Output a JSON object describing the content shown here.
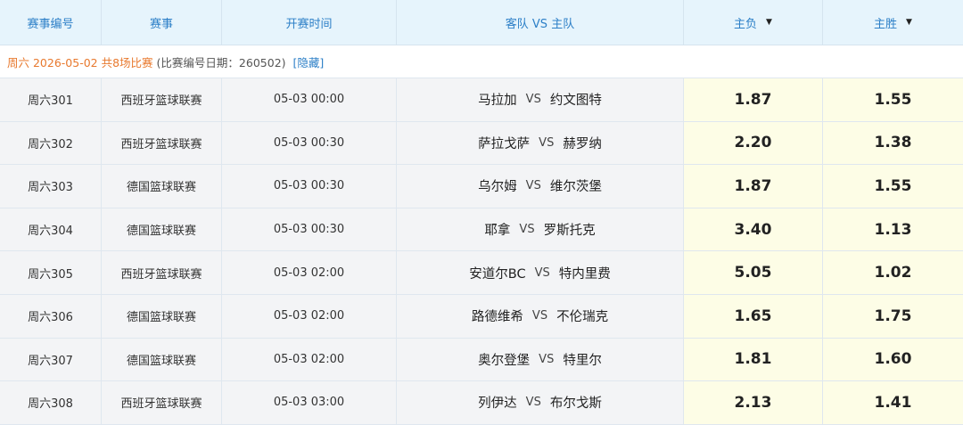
{
  "header": {
    "col_id": "赛事编号",
    "col_league": "赛事",
    "col_time": "开赛时间",
    "col_teams": "客队 VS 主队",
    "col_away_win": "主负",
    "col_home_win": "主胜",
    "sort_icon": "caret-down-icon"
  },
  "info": {
    "date_label": "周六 2026-05-02 共8场比赛",
    "meta_label": "(比赛编号日期：260502)",
    "hide_label": "[隐藏]"
  },
  "vs_label": "VS",
  "colors": {
    "header_bg": "#e6f4fc",
    "header_text": "#2c7fc7",
    "date_text": "#e8792e",
    "odds_bg": "#fdfde6",
    "row_bg": "#f3f4f6"
  },
  "matches": [
    {
      "id": "周六301",
      "league": "西班牙篮球联赛",
      "time": "05-03 00:00",
      "away": "马拉加",
      "home": "约文图特",
      "lose": "1.87",
      "win": "1.55"
    },
    {
      "id": "周六302",
      "league": "西班牙篮球联赛",
      "time": "05-03 00:30",
      "away": "萨拉戈萨",
      "home": "赫罗纳",
      "lose": "2.20",
      "win": "1.38"
    },
    {
      "id": "周六303",
      "league": "德国篮球联赛",
      "time": "05-03 00:30",
      "away": "乌尔姆",
      "home": "维尔茨堡",
      "lose": "1.87",
      "win": "1.55"
    },
    {
      "id": "周六304",
      "league": "德国篮球联赛",
      "time": "05-03 00:30",
      "away": "耶拿",
      "home": "罗斯托克",
      "lose": "3.40",
      "win": "1.13"
    },
    {
      "id": "周六305",
      "league": "西班牙篮球联赛",
      "time": "05-03 02:00",
      "away": "安道尔BC",
      "home": "特内里费",
      "lose": "5.05",
      "win": "1.02"
    },
    {
      "id": "周六306",
      "league": "德国篮球联赛",
      "time": "05-03 02:00",
      "away": "路德维希",
      "home": "不伦瑞克",
      "lose": "1.65",
      "win": "1.75"
    },
    {
      "id": "周六307",
      "league": "德国篮球联赛",
      "time": "05-03 02:00",
      "away": "奥尔登堡",
      "home": "特里尔",
      "lose": "1.81",
      "win": "1.60"
    },
    {
      "id": "周六308",
      "league": "西班牙篮球联赛",
      "time": "05-03 03:00",
      "away": "列伊达",
      "home": "布尔戈斯",
      "lose": "2.13",
      "win": "1.41"
    }
  ]
}
